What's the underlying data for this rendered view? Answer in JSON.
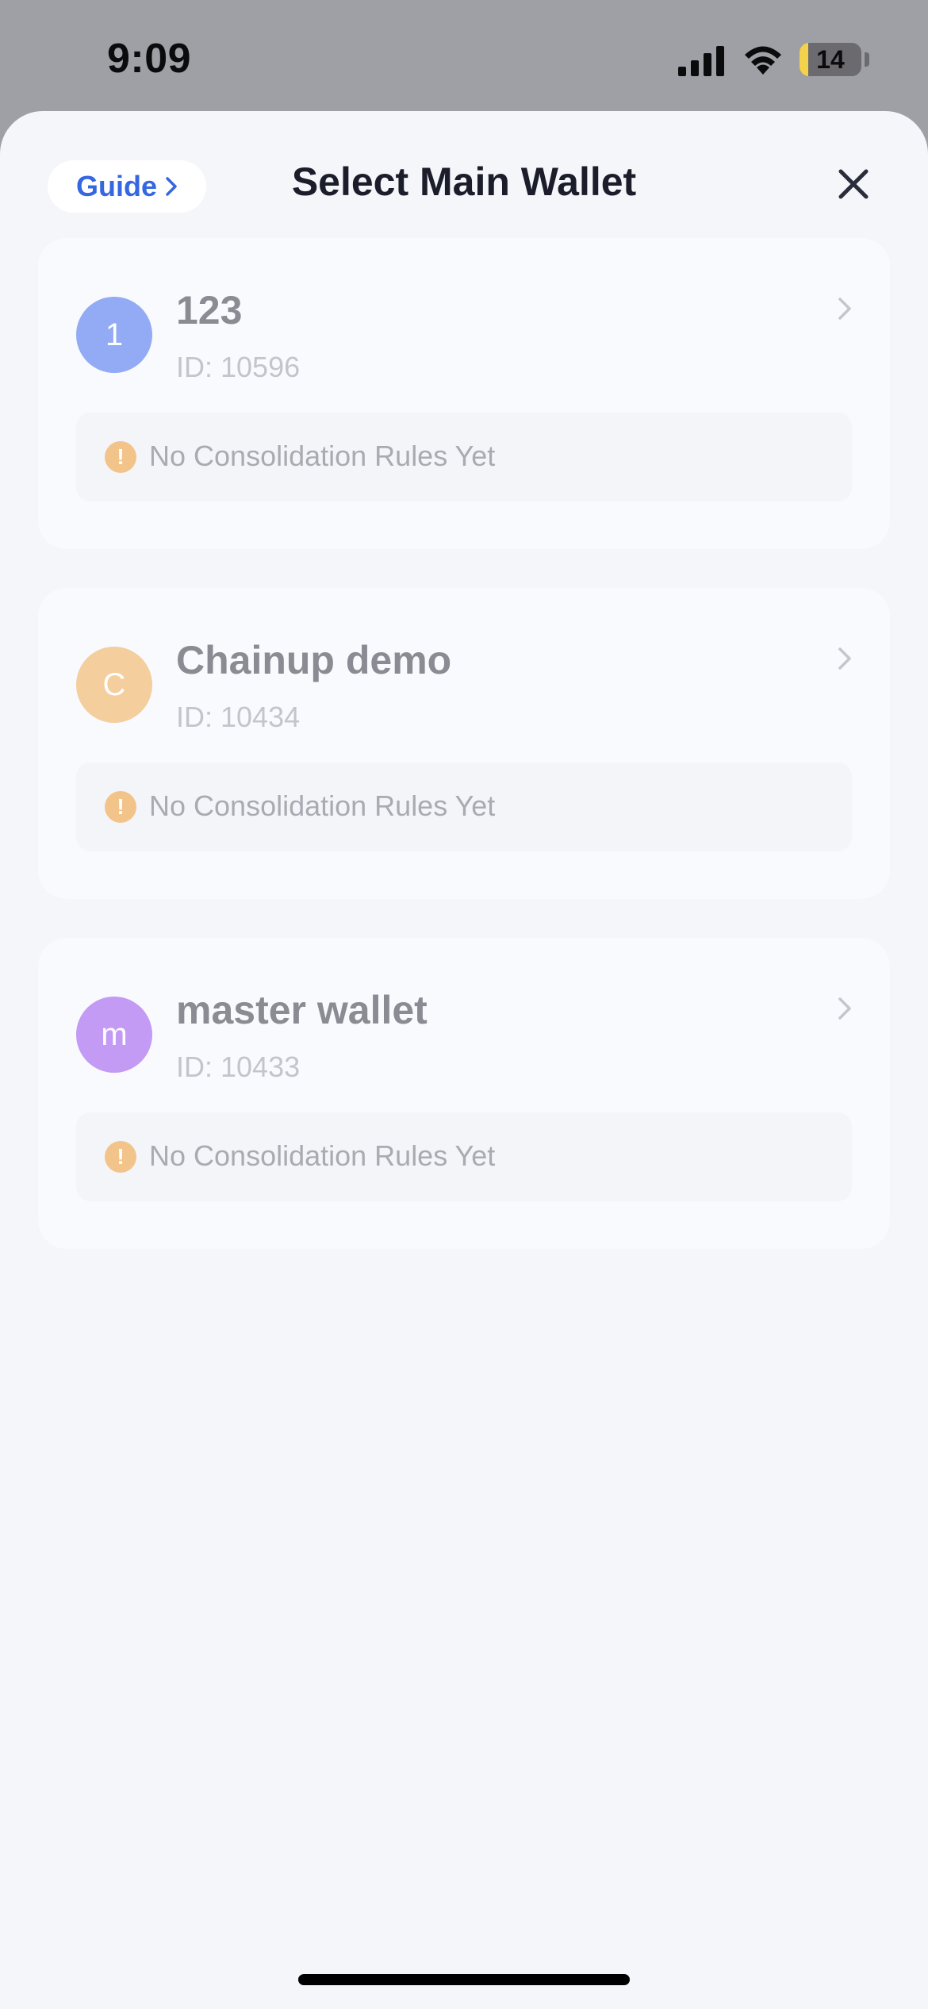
{
  "status_bar": {
    "time": "9:09",
    "battery_level": "14",
    "battery_fraction": 0.14
  },
  "header": {
    "guide_label": "Guide",
    "title": "Select Main Wallet",
    "close_icon": "close-icon"
  },
  "wallets": [
    {
      "initial": "1",
      "name": "123",
      "id": "ID: 10596",
      "avatar_color": "#93abf5",
      "rules_text": "No Consolidation Rules Yet"
    },
    {
      "initial": "C",
      "name": "Chainup demo",
      "id": "ID: 10434",
      "avatar_color": "#f4ce9c",
      "rules_text": "No Consolidation Rules Yet"
    },
    {
      "initial": "m",
      "name": "master wallet",
      "id": "ID: 10433",
      "avatar_color": "#c39af4",
      "rules_text": "No Consolidation Rules Yet"
    }
  ],
  "icons": {
    "warning": "warning-icon",
    "chevron": "chevron-right-icon"
  },
  "colors": {
    "accent": "#3567e0",
    "warning": "#f2c48a"
  }
}
